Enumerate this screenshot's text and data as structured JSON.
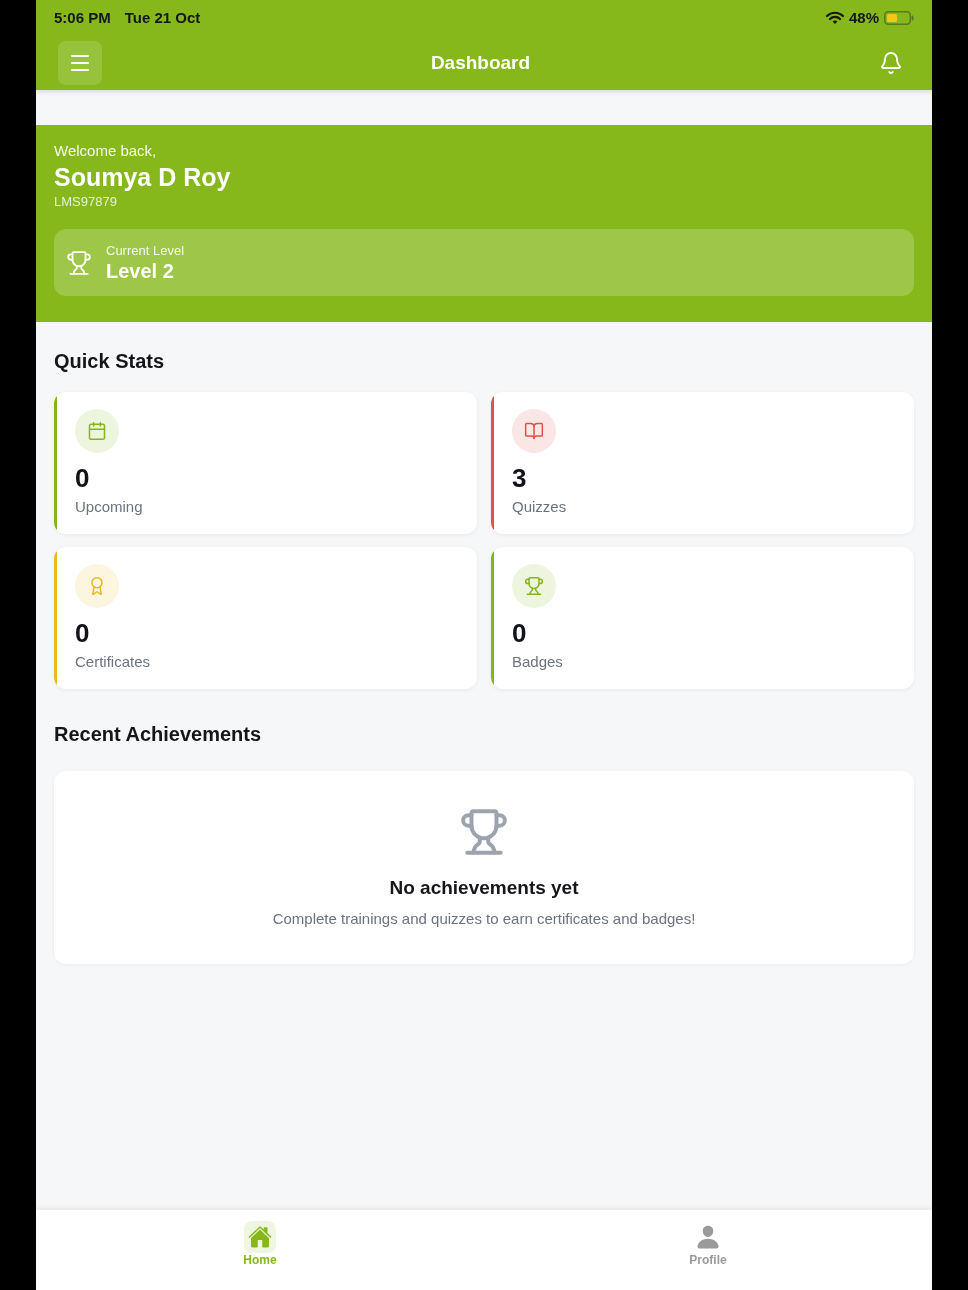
{
  "status_bar": {
    "time": "5:06 PM",
    "date": "Tue 21 Oct",
    "battery": "48%"
  },
  "header": {
    "title": "Dashboard"
  },
  "welcome": {
    "greeting": "Welcome back,",
    "name": "Soumya D Roy",
    "user_id": "LMS97879",
    "current_level": {
      "label": "Current Level",
      "value": "Level 2"
    }
  },
  "quick_stats": {
    "title": "Quick Stats",
    "cards": [
      {
        "kind": "calendar",
        "value": "0",
        "label": "Upcoming",
        "color": "#84b61b"
      },
      {
        "kind": "book",
        "value": "3",
        "label": "Quizzes",
        "color": "#e2504c"
      },
      {
        "kind": "award",
        "value": "0",
        "label": "Certificates",
        "color": "#e8b923"
      },
      {
        "kind": "trophy",
        "value": "0",
        "label": "Badges",
        "color": "#84b61b"
      }
    ]
  },
  "recent_achievements": {
    "title": "Recent Achievements",
    "empty_state": {
      "title": "No achievements yet",
      "message": "Complete trainings and quizzes to earn certificates and badges!"
    }
  },
  "bottom_nav": {
    "items": [
      {
        "kind": "home",
        "label": "Home",
        "selected": true
      },
      {
        "kind": "profile",
        "label": "Profile",
        "selected": false
      }
    ]
  }
}
